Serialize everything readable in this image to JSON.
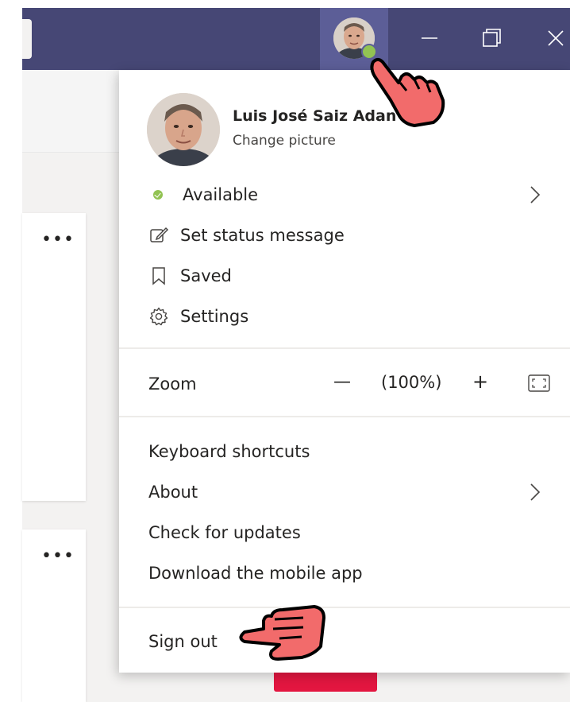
{
  "user": {
    "name": "Luis José Saiz Adan",
    "change_picture": "Change picture",
    "presence_color": "#92c353"
  },
  "menu": {
    "status": {
      "label": "Available",
      "icon": "presence-available-icon"
    },
    "set_status_message": {
      "label": "Set status message",
      "icon": "edit-note-icon"
    },
    "saved": {
      "label": "Saved",
      "icon": "bookmark-icon"
    },
    "settings": {
      "label": "Settings",
      "icon": "gear-icon"
    },
    "zoom": {
      "label": "Zoom",
      "decrease": "—",
      "value": "(100%)",
      "increase": "+"
    },
    "keyboard_shortcuts": {
      "label": "Keyboard shortcuts"
    },
    "about": {
      "label": "About"
    },
    "check_updates": {
      "label": "Check for updates"
    },
    "download_mobile": {
      "label": "Download the mobile app"
    },
    "sign_out": {
      "label": "Sign out"
    }
  },
  "page": {
    "more_options": "•••"
  },
  "colors": {
    "titlebar": "#464775",
    "avatar_button_bg": "#5c5e97",
    "accent_red": "#e31640",
    "pointer_hand": "#f26b6b"
  }
}
